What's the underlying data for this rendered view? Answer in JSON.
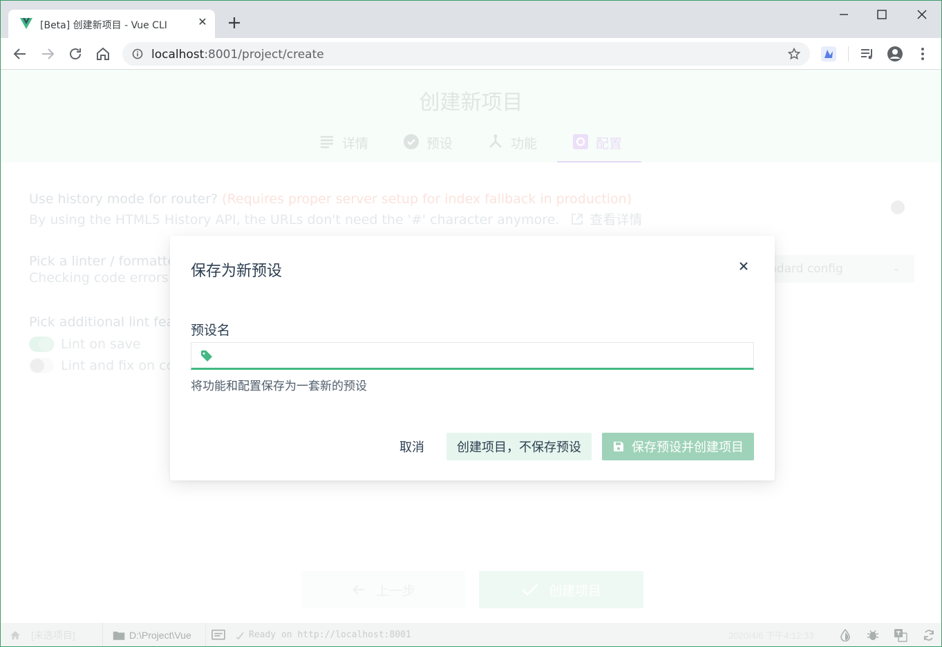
{
  "browser": {
    "tab_title": "[Beta] 创建新项目 - Vue CLI",
    "url_host": "localhost",
    "url_rest": ":8001/project/create"
  },
  "page": {
    "title": "创建新项目",
    "steps": [
      {
        "label": "详情",
        "icon": "list-icon"
      },
      {
        "label": "预设",
        "icon": "check-circle-icon"
      },
      {
        "label": "功能",
        "icon": "fork-icon"
      },
      {
        "label": "配置",
        "icon": "settings-app-icon"
      }
    ],
    "active_step": 3,
    "options": {
      "router_title": "Use history mode for router?",
      "router_warning": "(Requires proper server setup for index fallback in production)",
      "router_desc": "By using the HTML5 History API, the URLs don't need the '#' character anymore.",
      "router_link": "查看详情",
      "linter_title": "Pick a linter / formatter",
      "linter_desc": "Checking code errors a",
      "linter_select_value": "ndard config",
      "lint_features_title": "Pick additional lint feat",
      "lint_on_save": "Lint on save",
      "lint_fix_on_commit": "Lint and fix on co"
    },
    "prev_button": "上一步",
    "create_button": "创建项目"
  },
  "modal": {
    "title": "保存为新预设",
    "field_label": "预设名",
    "field_value": "",
    "hint": "将功能和配置保存为一套新的预设",
    "cancel": "取消",
    "create_without_save": "创建项目，不保存预设",
    "save_and_create": "保存预设并创建项目"
  },
  "statusbar": {
    "home_label": "[未选项目]",
    "path": "D:\\Project\\Vue",
    "log": "Ready on http://localhost:8001",
    "datetime": "2020/4/6 下午4:12:33"
  },
  "colors": {
    "accent": "#42b983",
    "accent_disabled": "#9fd3b9",
    "secondary_btn_bg": "#e6f6ee",
    "text": "#2c3e50"
  }
}
